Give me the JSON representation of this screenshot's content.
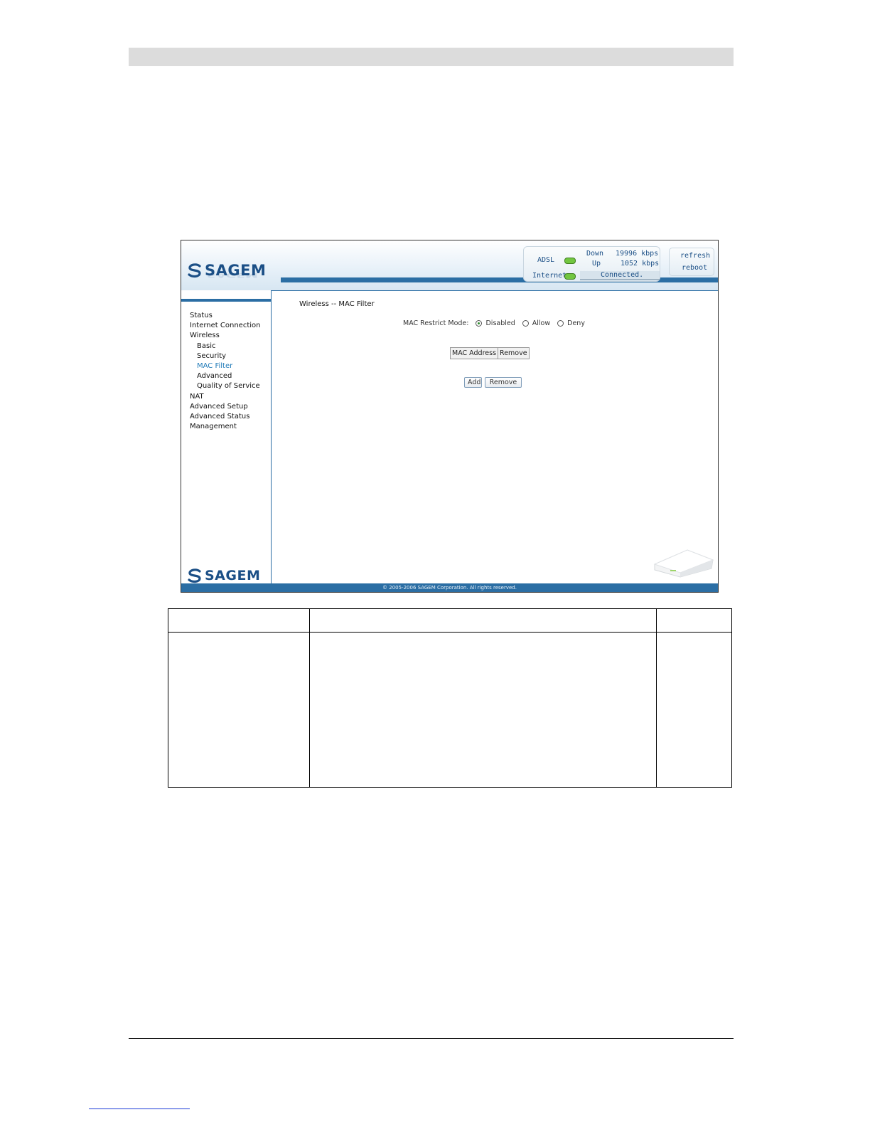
{
  "brand": {
    "name": "SAGEM",
    "color": "#1b4f86",
    "accent": "#2b6ea4"
  },
  "status_panel": {
    "adsl_label": "ADSL",
    "internet_label": "Internet",
    "down_label": "Down",
    "down_value": "19996 kbps",
    "up_label": "Up",
    "up_value": "1052 kbps",
    "connection": "Connected.",
    "led_color": "#72c640"
  },
  "actions": {
    "refresh": "refresh",
    "reboot": "reboot"
  },
  "nav": {
    "items": [
      {
        "label": "Status",
        "level": 0,
        "active": false
      },
      {
        "label": "Internet Connection",
        "level": 0,
        "active": false
      },
      {
        "label": "Wireless",
        "level": 0,
        "active": false
      },
      {
        "label": "Basic",
        "level": 1,
        "active": false
      },
      {
        "label": "Security",
        "level": 1,
        "active": false
      },
      {
        "label": "MAC Filter",
        "level": 1,
        "active": true
      },
      {
        "label": "Advanced",
        "level": 1,
        "active": false
      },
      {
        "label": "Quality of Service",
        "level": 1,
        "active": false
      },
      {
        "label": "NAT",
        "level": 0,
        "active": false
      },
      {
        "label": "Advanced Setup",
        "level": 0,
        "active": false
      },
      {
        "label": "Advanced Status",
        "level": 0,
        "active": false
      },
      {
        "label": "Management",
        "level": 0,
        "active": false
      }
    ]
  },
  "main": {
    "title": "Wireless -- MAC Filter",
    "mode_label": "MAC Restrict Mode:",
    "modes": [
      "Disabled",
      "Allow",
      "Deny"
    ],
    "selected_mode": "Disabled",
    "table_headers": [
      "MAC Address",
      "Remove"
    ],
    "add_button": "Add",
    "remove_button": "Remove"
  },
  "footer": {
    "copyright": "© 2005-2006 SAGEM Corporation. All rights reserved."
  }
}
